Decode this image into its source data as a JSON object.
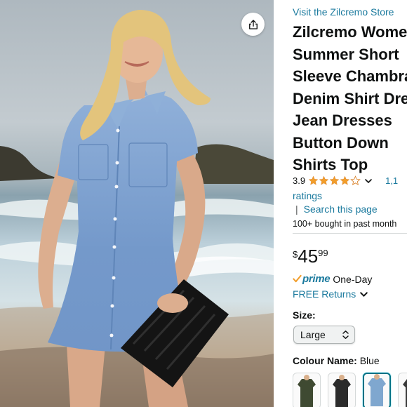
{
  "store": {
    "link_text": "Visit the Zilcremo Store"
  },
  "product": {
    "title_lines": [
      "Zilcremo Wome",
      "Summer Short",
      "Sleeve Chambra",
      "Denim Shirt Dre",
      "Jean Dresses",
      "Button Down",
      "Shirts Top"
    ]
  },
  "rating": {
    "value": "3.9",
    "stars_out_of_5": 3.9,
    "count_text": "1,1",
    "label": "ratings"
  },
  "search_link": {
    "separator": "|",
    "text": "Search this page"
  },
  "bought_text": "100+ bought in past month",
  "price": {
    "symbol": "$",
    "whole": "45",
    "fraction": "99"
  },
  "delivery": {
    "prime_label": "prime",
    "speed": "One-Day",
    "returns": "FREE Returns"
  },
  "size": {
    "label": "Size:",
    "selected": "Large"
  },
  "colour": {
    "label": "Colour Name:",
    "selected": "Blue"
  },
  "swatches": [
    {
      "colour": "#3f4a32",
      "selected": false
    },
    {
      "colour": "#2b2b2b",
      "selected": false
    },
    {
      "colour": "#7fa7cf",
      "selected": true
    },
    {
      "colour": "#3a3a3a",
      "selected": false
    }
  ],
  "colors": {
    "link": "#1b7a9e",
    "star": "#f29e2b",
    "text": "#0f1111",
    "selected_border": "#007185"
  },
  "icons": {
    "share": "share-icon",
    "rating_dropdown": "chevron-down-icon",
    "returns_dropdown": "chevron-down-icon",
    "size_select": "up-down-chevron-icon",
    "prime": "check-icon"
  }
}
